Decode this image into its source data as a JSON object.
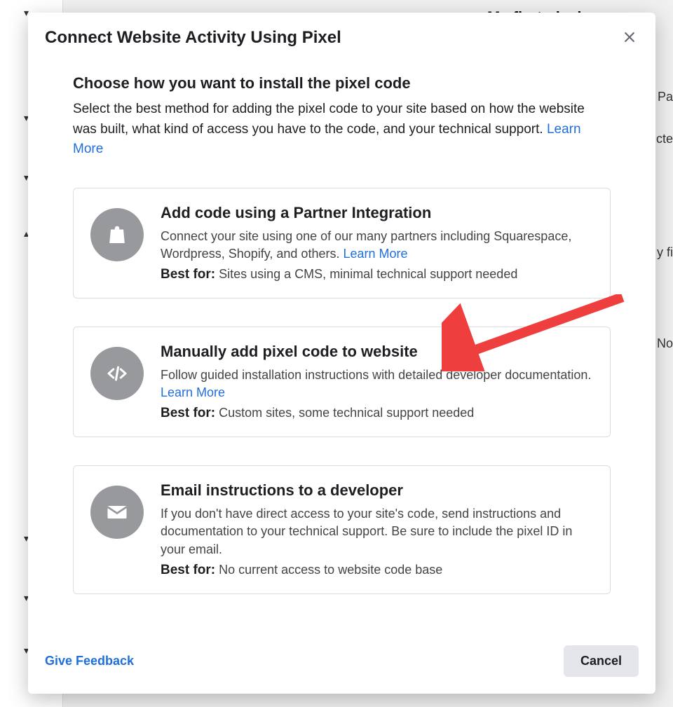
{
  "background": {
    "topPixelTitle": "My first pixel",
    "rightLabels": {
      "pa": "Pa",
      "cte": "cte",
      "fi": "y fi",
      "no": "No"
    }
  },
  "modal": {
    "title": "Connect Website Activity Using Pixel",
    "intro": {
      "heading": "Choose how you want to install the pixel code",
      "desc": "Select the best method for adding the pixel code to your site based on how the website was built, what kind of access you have to the code, and your technical support. ",
      "learnMoreLabel": "Learn More"
    },
    "options": [
      {
        "icon": "shopping-bag-icon",
        "title": "Add code using a Partner Integration",
        "desc": "Connect your site using one of our many partners including Squarespace, Wordpress, Shopify, and others. ",
        "learnMoreLabel": "Learn More",
        "bestForLabel": "Best for:",
        "bestForText": " Sites using a CMS, minimal technical support needed"
      },
      {
        "icon": "code-icon",
        "title": "Manually add pixel code to website",
        "desc": "Follow guided installation instructions with detailed developer documentation. ",
        "learnMoreLabel": "Learn More",
        "bestForLabel": "Best for:",
        "bestForText": " Custom sites, some technical support needed"
      },
      {
        "icon": "mail-icon",
        "title": "Email instructions to a developer",
        "desc": "If you don't have direct access to your site's code, send instructions and documentation to your technical support. Be sure to include the pixel ID in your email.",
        "learnMoreLabel": "",
        "bestForLabel": "Best for:",
        "bestForText": " No current access to website code base"
      }
    ],
    "footer": {
      "feedback": "Give Feedback",
      "cancel": "Cancel"
    }
  }
}
